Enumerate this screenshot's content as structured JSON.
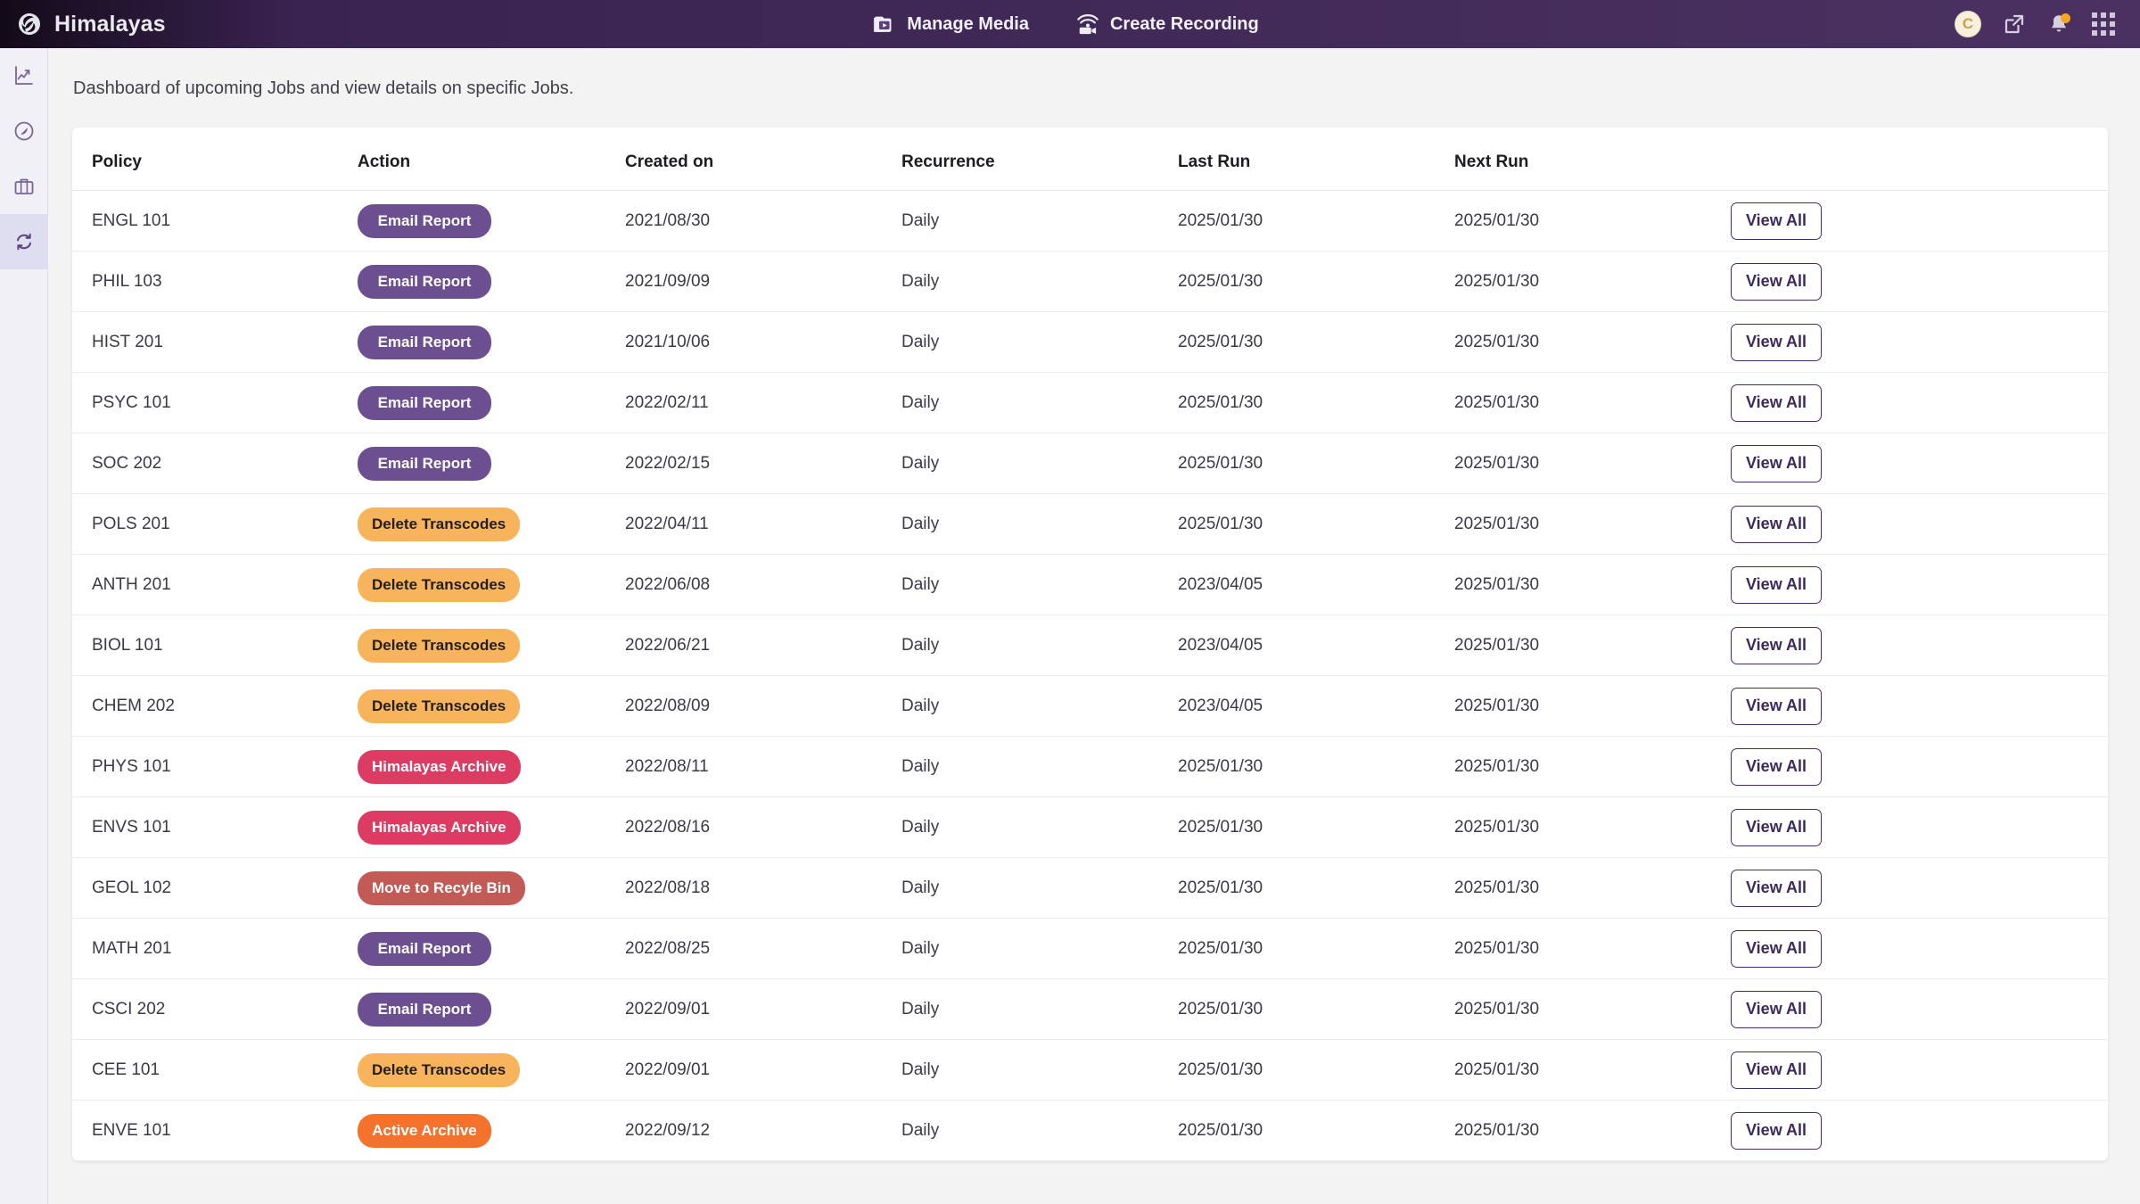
{
  "header": {
    "brand": "Himalayas",
    "logo_icon": "himalayas-swirl-logo",
    "nav": [
      {
        "label": "Manage Media",
        "icon": "manage-media-folder-play-icon"
      },
      {
        "label": "Create Recording",
        "icon": "create-recording-camera-wifi-icon"
      }
    ],
    "avatar_initial": "C",
    "actions": [
      {
        "icon": "external-link-icon"
      },
      {
        "icon": "notification-bell-icon",
        "has_badge": true
      },
      {
        "icon": "apps-grid-icon"
      }
    ]
  },
  "sidebar": {
    "items": [
      {
        "icon": "analytics-chart-icon",
        "active": false
      },
      {
        "icon": "compass-explore-icon",
        "active": false
      },
      {
        "icon": "briefcase-icon",
        "active": false
      },
      {
        "icon": "sync-refresh-jobs-icon",
        "active": true
      }
    ]
  },
  "main": {
    "description": "Dashboard of upcoming Jobs and view details on specific Jobs.",
    "table": {
      "columns": [
        "Policy",
        "Action",
        "Created on",
        "Recurrence",
        "Last Run",
        "Next Run",
        ""
      ],
      "view_all_label": "View All",
      "rows": [
        {
          "policy": "ENGL 101",
          "action": "Email Report",
          "action_type": "email-report",
          "created": "2021/08/30",
          "recurrence": "Daily",
          "last_run": "2025/01/30",
          "next_run": "2025/01/30"
        },
        {
          "policy": "PHIL 103",
          "action": "Email Report",
          "action_type": "email-report",
          "created": "2021/09/09",
          "recurrence": "Daily",
          "last_run": "2025/01/30",
          "next_run": "2025/01/30"
        },
        {
          "policy": "HIST 201",
          "action": "Email Report",
          "action_type": "email-report",
          "created": "2021/10/06",
          "recurrence": "Daily",
          "last_run": "2025/01/30",
          "next_run": "2025/01/30"
        },
        {
          "policy": "PSYC 101",
          "action": "Email Report",
          "action_type": "email-report",
          "created": "2022/02/11",
          "recurrence": "Daily",
          "last_run": "2025/01/30",
          "next_run": "2025/01/30"
        },
        {
          "policy": "SOC 202",
          "action": "Email Report",
          "action_type": "email-report",
          "created": "2022/02/15",
          "recurrence": "Daily",
          "last_run": "2025/01/30",
          "next_run": "2025/01/30"
        },
        {
          "policy": "POLS 201",
          "action": "Delete Transcodes",
          "action_type": "delete-transcodes",
          "created": "2022/04/11",
          "recurrence": "Daily",
          "last_run": "2025/01/30",
          "next_run": "2025/01/30"
        },
        {
          "policy": "ANTH 201",
          "action": "Delete Transcodes",
          "action_type": "delete-transcodes",
          "created": "2022/06/08",
          "recurrence": "Daily",
          "last_run": "2023/04/05",
          "next_run": "2025/01/30"
        },
        {
          "policy": "BIOL 101",
          "action": "Delete Transcodes",
          "action_type": "delete-transcodes",
          "created": "2022/06/21",
          "recurrence": "Daily",
          "last_run": "2023/04/05",
          "next_run": "2025/01/30"
        },
        {
          "policy": "CHEM 202",
          "action": "Delete Transcodes",
          "action_type": "delete-transcodes",
          "created": "2022/08/09",
          "recurrence": "Daily",
          "last_run": "2023/04/05",
          "next_run": "2025/01/30"
        },
        {
          "policy": "PHYS 101",
          "action": "Himalayas Archive",
          "action_type": "himalayas-archive",
          "created": "2022/08/11",
          "recurrence": "Daily",
          "last_run": "2025/01/30",
          "next_run": "2025/01/30"
        },
        {
          "policy": "ENVS 101",
          "action": "Himalayas Archive",
          "action_type": "himalayas-archive",
          "created": "2022/08/16",
          "recurrence": "Daily",
          "last_run": "2025/01/30",
          "next_run": "2025/01/30"
        },
        {
          "policy": "GEOL 102",
          "action": "Move to Recyle Bin",
          "action_type": "move-to-recyle-bin",
          "created": "2022/08/18",
          "recurrence": "Daily",
          "last_run": "2025/01/30",
          "next_run": "2025/01/30"
        },
        {
          "policy": "MATH 201",
          "action": "Email Report",
          "action_type": "email-report",
          "created": "2022/08/25",
          "recurrence": "Daily",
          "last_run": "2025/01/30",
          "next_run": "2025/01/30"
        },
        {
          "policy": "CSCI 202",
          "action": "Email Report",
          "action_type": "email-report",
          "created": "2022/09/01",
          "recurrence": "Daily",
          "last_run": "2025/01/30",
          "next_run": "2025/01/30"
        },
        {
          "policy": "CEE 101",
          "action": "Delete Transcodes",
          "action_type": "delete-transcodes",
          "created": "2022/09/01",
          "recurrence": "Daily",
          "last_run": "2025/01/30",
          "next_run": "2025/01/30"
        },
        {
          "policy": "ENVE 101",
          "action": "Active Archive",
          "action_type": "active-archive",
          "created": "2022/09/12",
          "recurrence": "Daily",
          "last_run": "2025/01/30",
          "next_run": "2025/01/30"
        }
      ]
    }
  },
  "colors": {
    "header_purple": "#3a2351",
    "accent_purple": "#6b4f91",
    "badge_email_report": "#6b4f91",
    "badge_delete_transcodes": "#f7b45c",
    "badge_himalayas_archive": "#dc3c62",
    "badge_move_to_recyle_bin": "#c35a55",
    "badge_active_archive": "#f4722b",
    "sidebar_active": "#dedef0",
    "page_background": "#f3f3f4"
  }
}
